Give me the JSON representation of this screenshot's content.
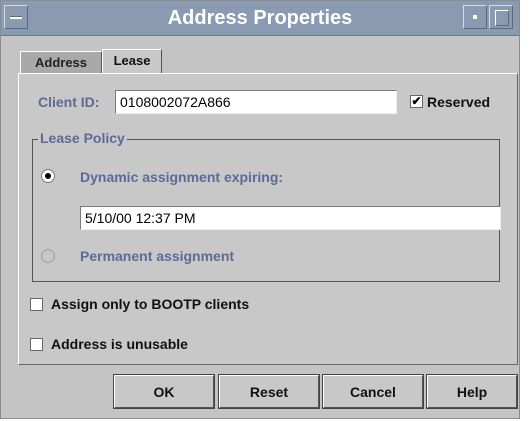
{
  "window": {
    "title": "Address Properties"
  },
  "tabs": [
    {
      "label": "Address",
      "selected": false
    },
    {
      "label": "Lease",
      "selected": true
    }
  ],
  "client": {
    "label": "Client ID:",
    "value": "0108002072A866"
  },
  "reserved": {
    "label": "Reserved",
    "checked": true,
    "mark": "✔"
  },
  "lease_policy": {
    "title": "Lease Policy",
    "dynamic": {
      "label": "Dynamic assignment expiring:",
      "selected": true
    },
    "expiry_value": "5/10/00 12:37 PM",
    "permanent": {
      "label": "Permanent assignment",
      "selected": false
    }
  },
  "options": {
    "bootp": {
      "label": "Assign only to BOOTP clients",
      "checked": false
    },
    "unusable": {
      "label": "Address is unusable",
      "checked": false
    }
  },
  "buttons": {
    "ok": "OK",
    "reset": "Reset",
    "cancel": "Cancel",
    "help": "Help"
  },
  "colors": {
    "titlebar": "#8a9ab0",
    "label_blue": "#5c6a98",
    "window_bg": "#c4c4c4"
  },
  "icons": {
    "window_menu": "window-menu-icon",
    "minimize": "minimize-icon",
    "maximize": "maximize-icon",
    "check": "checkmark-icon"
  }
}
